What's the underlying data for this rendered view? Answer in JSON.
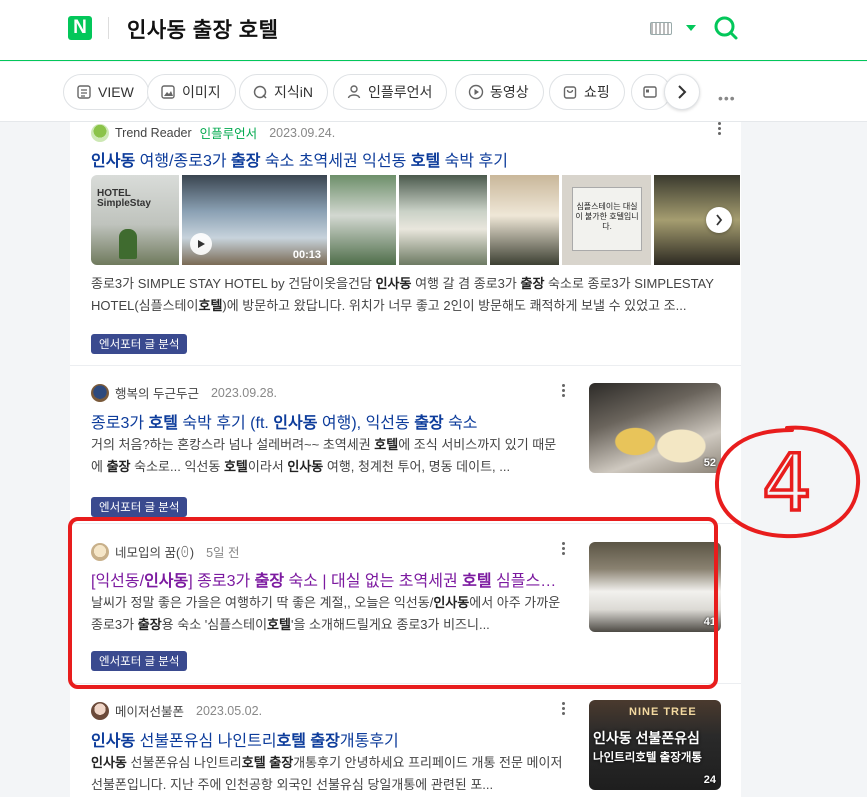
{
  "header": {
    "logo": "N",
    "query": "인사동 출장 호텔"
  },
  "tabs": [
    {
      "label": "VIEW",
      "icon": "view-icon"
    },
    {
      "label": "이미지",
      "icon": "image-icon"
    },
    {
      "label": "지식iN",
      "icon": "kin-icon"
    },
    {
      "label": "인플루언서",
      "icon": "person-icon"
    },
    {
      "label": "동영상",
      "icon": "play-icon"
    },
    {
      "label": "쇼핑",
      "icon": "shopping-icon"
    }
  ],
  "results": [
    {
      "author": "Trend Reader",
      "influencer": "인플루언서",
      "date": "2023.09.24.",
      "title_html": "<b>인사동</b> 여행/종로3가 <b>출장</b> 숙소 초역세권 익선동 <b>호텔</b> 숙박 후기",
      "desc_html": "종로3가 SIMPLE STAY HOTEL by 건담이옷을건담 <b>인사동</b> 여행 갈 겸 종로3가 <b>출장</b> 숙소로 종로3가 SIMPLESTAY HOTEL(심플스테이<b>호텔</b>)에 방문하고 왔답니다. 위치가 너무 좋고 2인이 방문해도 쾌적하게 보낼 수 있었고 조...",
      "tag": "엔서포터 글 분석",
      "strip_logo": "HOTEL SimpleStay",
      "video_duration": "00:13",
      "sign_text": "심플스테이는 대실이 불가한 호텔입니다."
    },
    {
      "author": "행복의 두근두근",
      "date": "2023.09.28.",
      "title_html": "종로3가 <b>호텔</b> 숙박 후기 (ft. <b>인사동</b> 여행), 익선동 <b>출장</b> 숙소",
      "desc_html": "거의 처음?하는 혼캉스라 넘나 설레버려~~ 초역세권 <b>호텔</b>에 조식 서비스까지 있기 때문에 <b>출장</b> 숙소로... 익선동 <b>호텔</b>이라서 <b>인사동</b> 여행, 청계천 투어, 명동 데이트, ...",
      "tag": "엔서포터 글 분석",
      "photo_count": "52"
    },
    {
      "author": "네모입의 꿈(ꏿ)",
      "date": "5일 전",
      "title_html": "[익선동/<b>인사동</b>] 종로3가 <b>출장</b> 숙소 | 대실 없는 초역세권 <b>호텔</b> 심플스테이...",
      "desc_html": "날씨가 정말 좋은 가을은 여행하기 딱 좋은 계절,, 오늘은 익선동/<b>인사동</b>에서 아주 가까운 종로3가 <b>출장</b>용 숙소 '심플스테이<b>호텔</b>'을 소개해드릴게요 종로3가 비즈니...",
      "tag": "엔서포터 글 분석",
      "photo_count": "41"
    },
    {
      "author": "메이저선불폰",
      "date": "2023.05.02.",
      "title_html": "<b>인사동</b> 선불폰유심 나인트리<b>호텔 출장</b>개통후기",
      "desc_html": "<b>인사동</b> 선불폰유심 나인트리<b>호텔 출장</b>개통후기 안녕하세요 프리페이드 개통 전문 메이저 선불폰입니다. 지난 주에 인천공항 외국인 선불유심 당일개통에 관련된 포...",
      "photo_count": "24",
      "thumb_sign": "NINE TREE",
      "thumb_line1": "인사동 선불폰유심",
      "thumb_line2": "나인트리호텔 출장개통"
    }
  ],
  "annotation": {
    "number": "4",
    "color": "#e81d1d"
  },
  "colors": {
    "accent": "#03c75a",
    "title_link": "#0d3c9b",
    "visited_link": "#7c1aa0",
    "tag_bg": "#3a4a8f"
  }
}
